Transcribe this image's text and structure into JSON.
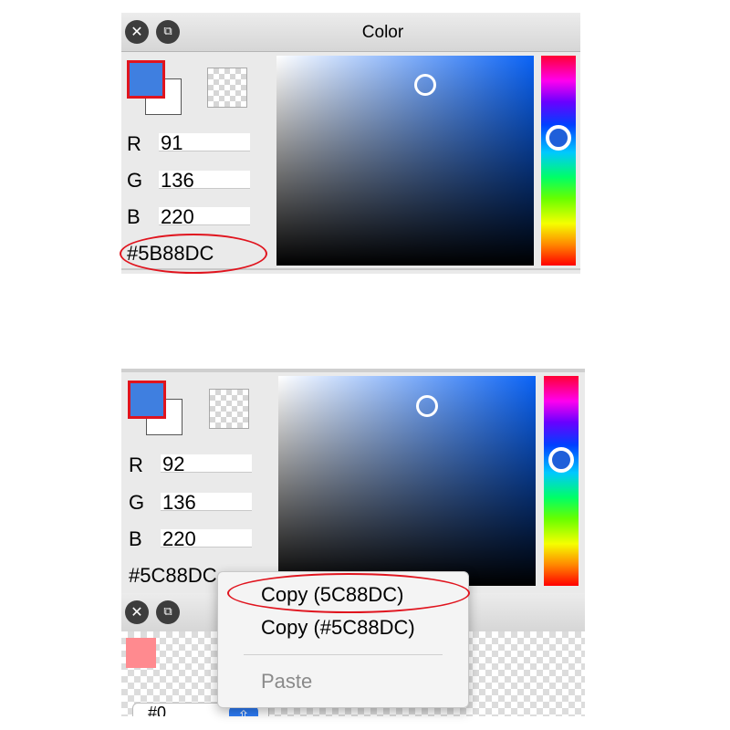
{
  "top_panel": {
    "title": "Color",
    "close_glyph": "✕",
    "restore_glyph": "⧉",
    "r_label": "R",
    "r_value": "91",
    "g_label": "G",
    "g_value": "136",
    "b_label": "B",
    "b_value": "220",
    "hex": "#5B88DC",
    "foreground_color": "#3f7fe0"
  },
  "bottom_panel": {
    "r_label": "R",
    "r_value": "92",
    "g_label": "G",
    "g_value": "136",
    "b_label": "B",
    "b_value": "220",
    "hex": "#5C88DC",
    "foreground_color": "#3f7fe0",
    "close_glyph": "✕",
    "restore_glyph": "⧉",
    "sub_tab_text": "#0",
    "sub_tab_up_glyph": "⇧"
  },
  "context_menu": {
    "items": [
      {
        "label": "Copy (5C88DC)",
        "enabled": true,
        "highlighted": true
      },
      {
        "label": "Copy (#5C88DC)",
        "enabled": true
      },
      {
        "label": "Paste",
        "enabled": false
      }
    ]
  },
  "colors": {
    "annotation_red": "#e0141e",
    "disabled_text": "#8a8a8a"
  }
}
